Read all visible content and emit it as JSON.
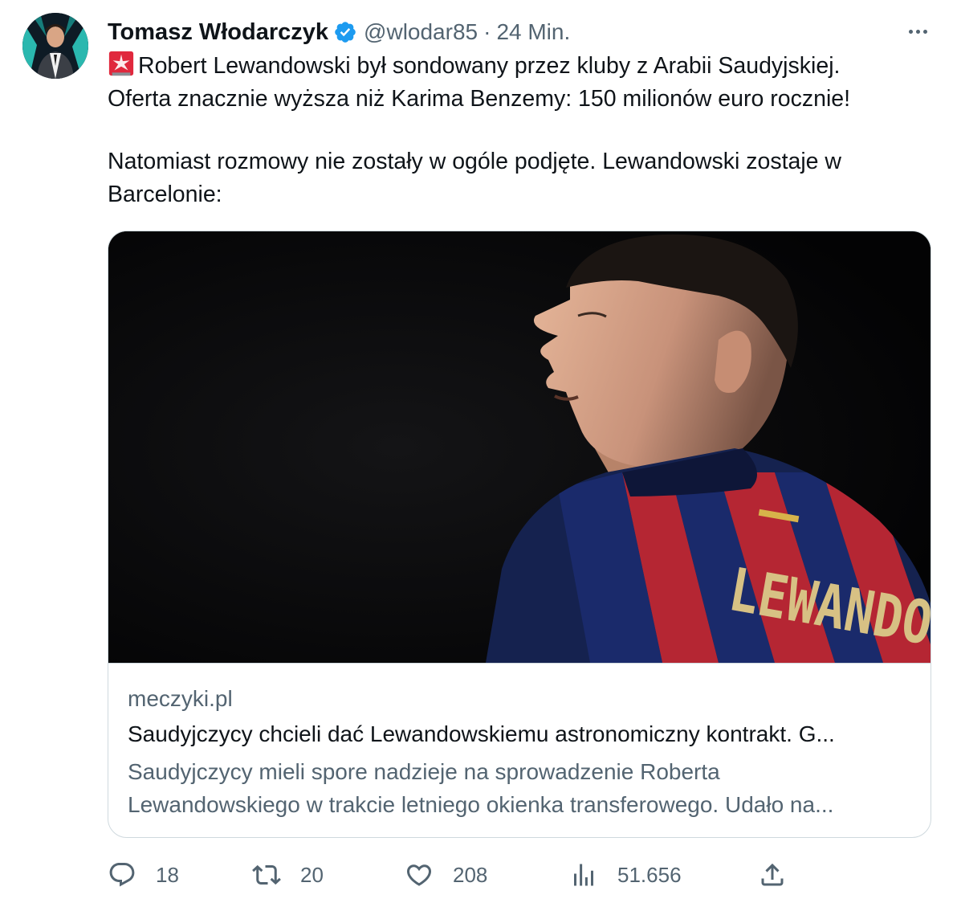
{
  "tweet": {
    "author_name": "Tomasz Włodarczyk",
    "handle": "@wlodar85",
    "separator": "·",
    "time": "24 Min.",
    "text_line1": "Robert Lewandowski był sondowany przez kluby z Arabii Saudyjskiej.",
    "text_line2": "Oferta znacznie wyższa niż Karima Benzemy: 150 milionów euro rocznie!",
    "text_line3": "Natomiast rozmowy nie zostały w ogóle podjęte. Lewandowski zostaje w",
    "text_line4": "Barcelonie:",
    "emoji_icon": "rotating-light-icon"
  },
  "card": {
    "image_jersey_text": "LEWANDOWSKI",
    "domain": "meczyki.pl",
    "title": "Saudyjczycy chcieli dać Lewandowskiemu astronomiczny kontrakt. G...",
    "description_line1": "Saudyjczycy mieli spore nadzieje na sprowadzenie Roberta",
    "description_line2": "Lewandowskiego w trakcie letniego okienka transferowego. Udało na..."
  },
  "actions": {
    "replies": "18",
    "retweets": "20",
    "likes": "208",
    "views": "51.656"
  },
  "colors": {
    "text_primary": "#0f1419",
    "text_secondary": "#536471",
    "verified_blue": "#1d9bf0",
    "border": "#cfd9de",
    "siren_red": "#e0283d"
  }
}
